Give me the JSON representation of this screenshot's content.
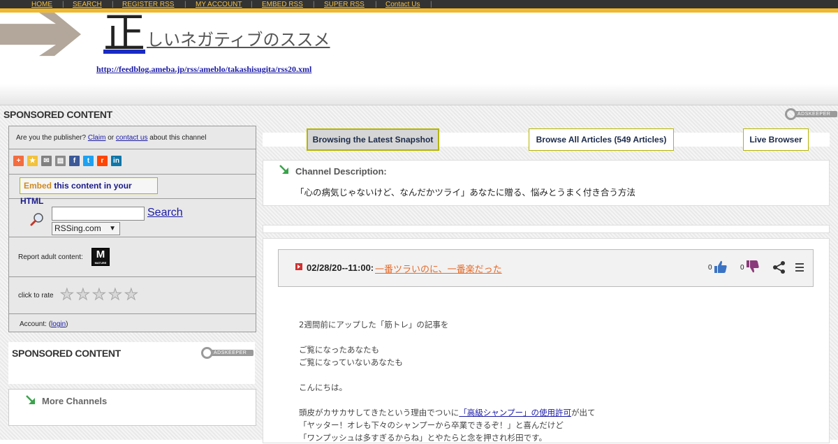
{
  "nav": {
    "items": [
      "HOME",
      "SEARCH",
      "REGISTER RSS",
      "MY ACCOUNT",
      "EMBED RSS",
      "SUPER RSS",
      "Contact Us"
    ]
  },
  "header": {
    "title_first_char": "正",
    "title_rest": "しいネガティブのススメ",
    "feed_url": "http://feedblog.ameba.jp/rss/ameblo/takashisugita/rss20.xml"
  },
  "sponsored": {
    "label": "SPONSORED CONTENT",
    "adkeeper_label": "ADSKEEPER"
  },
  "publisher": {
    "prefix": "Are you the publisher?",
    "claim": "Claim",
    "or": "or",
    "contact": "contact us",
    "suffix": "about this channel"
  },
  "share_icons": [
    "plus-icon",
    "star-icon",
    "email-icon",
    "print-icon",
    "facebook-icon",
    "twitter-icon",
    "reddit-icon",
    "linkedin-icon"
  ],
  "embed": {
    "word": "Embed",
    "rest": "this content in your HTML"
  },
  "search": {
    "button_label": "Search",
    "input_value": "",
    "select_value": "RSSing.com",
    "select_arrow": "▼"
  },
  "report": {
    "label": "Report adult content:",
    "badge_letter": "M",
    "badge_sub": "MATURE"
  },
  "rating": {
    "label": "click to rate",
    "stars": 5,
    "value": 0
  },
  "account": {
    "prefix": "Account: (",
    "login": "login",
    "suffix": ")"
  },
  "more_channels": {
    "label": "More Channels"
  },
  "tabs": {
    "latest": "Browsing the Latest Snapshot",
    "all": "Browse All Articles (549 Articles)",
    "live": "Live Browser"
  },
  "channel": {
    "label": "Channel Description:",
    "description": "「心の病気じゃないけど、なんだかツライ」あなたに贈る、悩みとうまく付き合う方法"
  },
  "article": {
    "date": "02/28/20--11:00:",
    "title": "一番ツラいのに、一番楽だった",
    "upvotes": "0",
    "downvotes": "0",
    "body": [
      "2週間前にアップした「筋トレ」の記事を",
      "",
      "ご覧になったあなたも",
      "ご覧になっていないあなたも",
      "",
      "こんにちは。",
      ""
    ],
    "body_line_pre": "頭皮がカサカサしてきたという理由でついに",
    "body_link": "「高級シャンプー」の使用許可",
    "body_line_post": "が出て",
    "body_after": [
      "「ヤッター！オレも下々のシャンプーから卒業できるぞ！」と喜んだけど",
      "「ワンプッシュは多すぎるからね」とやたらと念を押され杉田です。"
    ]
  },
  "colors": {
    "nav_bg": "#333333",
    "nav_gold": "#f0b82c",
    "link_blue": "#1a1aa6",
    "title_orange": "#e46b2a",
    "tab_border": "#b5b500"
  }
}
